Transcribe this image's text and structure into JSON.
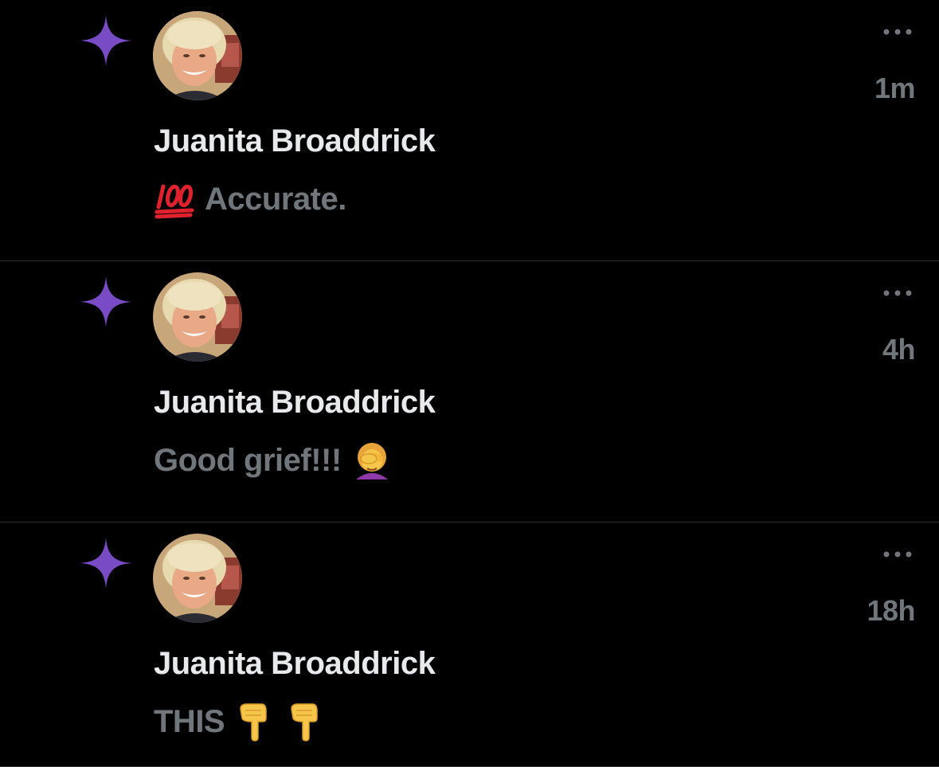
{
  "notifications": [
    {
      "author": "Juanita Broaddrick",
      "time": "1m",
      "text": "Accurate.",
      "emoji_before": "hundred-points-emoji",
      "emoji_after": []
    },
    {
      "author": "Juanita Broaddrick",
      "time": "4h",
      "text": "Good grief!!!",
      "emoji_before": null,
      "emoji_after": [
        "woman-facepalming-emoji"
      ]
    },
    {
      "author": "Juanita Broaddrick",
      "time": "18h",
      "text": "THIS",
      "emoji_before": null,
      "emoji_after": [
        "backhand-index-pointing-down-emoji",
        "backhand-index-pointing-down-emoji"
      ]
    }
  ],
  "colors": {
    "background": "#000000",
    "name_text": "#e7e9ea",
    "secondary_text": "#71767b",
    "star_accent": "#794bc4",
    "divider": "#2f3336"
  },
  "icons": {
    "notification_type": "sparkle-star-icon",
    "menu": "more-dots-icon"
  }
}
